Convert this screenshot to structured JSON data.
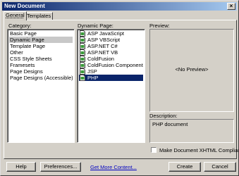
{
  "window": {
    "title": "New Document",
    "close_glyph": "×"
  },
  "tabs": [
    {
      "label": "General",
      "active": true
    },
    {
      "label": "Templates",
      "active": false
    }
  ],
  "category": {
    "label": "Category:",
    "items": [
      "Basic Page",
      "Dynamic Page",
      "Template Page",
      "Other",
      "CSS Style Sheets",
      "Framesets",
      "Page Designs",
      "Page Designs (Accessible)"
    ],
    "selected": "Dynamic Page"
  },
  "dynamic_page": {
    "label": "Dynamic Page:",
    "items": [
      "ASP JavaScript",
      "ASP VBScript",
      "ASP.NET C#",
      "ASP.NET VB",
      "ColdFusion",
      "ColdFusion Component",
      "JSP",
      "PHP"
    ],
    "selected": "PHP"
  },
  "preview": {
    "label": "Preview:",
    "placeholder": "<No Preview>"
  },
  "description": {
    "label": "Description:",
    "text": "PHP document"
  },
  "xhtml_checkbox": {
    "label": "Make Document XHTML Compliant",
    "checked": false
  },
  "buttons": {
    "help": "Help",
    "preferences": "Preferences...",
    "get_more": "Get More Content...",
    "create": "Create",
    "cancel": "Cancel"
  },
  "colors": {
    "selection_blue": "#0a246a",
    "link": "#0000c0",
    "title_bar": "#0a246a"
  }
}
